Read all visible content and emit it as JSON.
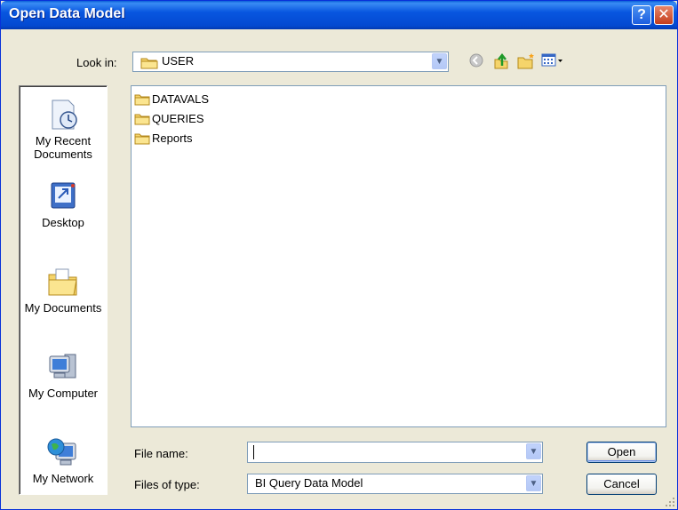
{
  "window": {
    "title": "Open Data Model",
    "help_glyph": "?",
    "close_glyph": "✕"
  },
  "lookin": {
    "label": "Look in:",
    "value": "USER",
    "icon": "folder-icon"
  },
  "toolbar": {
    "icons": [
      "back-icon",
      "up-one-level-icon",
      "new-folder-icon",
      "view-menu-icon"
    ]
  },
  "places": [
    {
      "label": "My Recent Documents",
      "icon": "recent-documents-icon"
    },
    {
      "label": "Desktop",
      "icon": "desktop-icon"
    },
    {
      "label": "My Documents",
      "icon": "my-documents-icon"
    },
    {
      "label": "My Computer",
      "icon": "my-computer-icon"
    },
    {
      "label": "My Network",
      "icon": "my-network-icon"
    }
  ],
  "files": [
    {
      "name": "DATAVALS",
      "icon": "folder-icon"
    },
    {
      "name": "QUERIES",
      "icon": "folder-icon"
    },
    {
      "name": "Reports",
      "icon": "folder-icon"
    }
  ],
  "filename": {
    "label": "File name:",
    "value": ""
  },
  "filetype": {
    "label": "Files of type:",
    "value": "BI Query Data Model"
  },
  "buttons": {
    "open": "Open",
    "cancel": "Cancel"
  },
  "colors": {
    "titlebar": "#0450d8",
    "dialog_bg": "#ece9d8",
    "folder_yellow": "#f5d46b"
  }
}
